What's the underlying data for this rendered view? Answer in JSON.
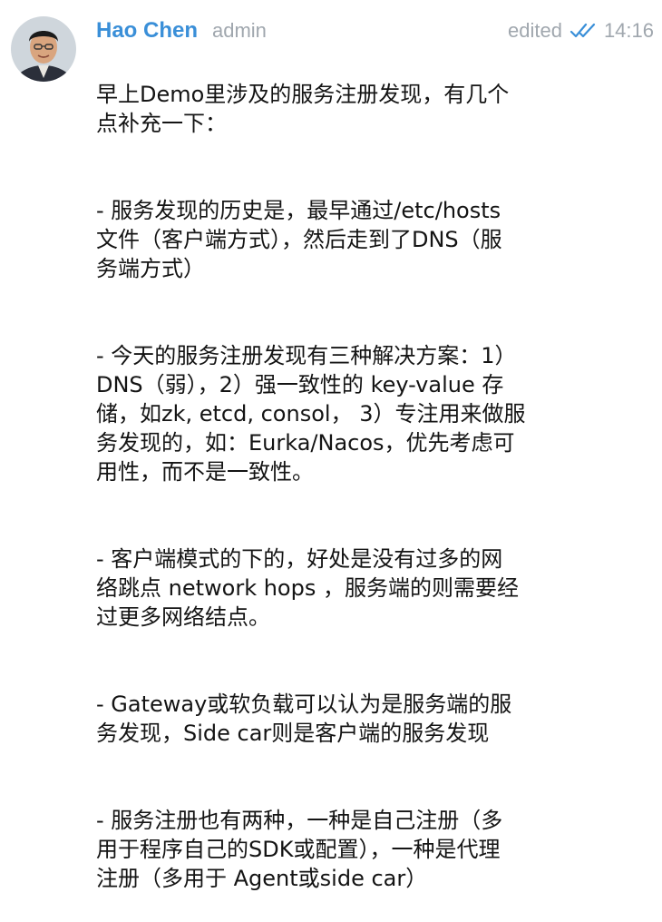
{
  "message": {
    "sender": "Hao Chen",
    "role": "admin",
    "edited_label": "edited",
    "time": "14:16",
    "status_icon": "double-check-icon",
    "accent_color": "#3a8fd8",
    "meta_color": "#a0a7ae",
    "paragraphs": [
      "早上Demo里涉及的服务注册发现，有几个\n点补充一下：",
      "- 服务发现的历史是，最早通过/etc/hosts\n文件（客户端方式），然后走到了DNS（服\n务端方式）",
      "- 今天的服务注册发现有三种解决方案：1）\nDNS（弱），2）强一致性的 key-value 存\n储，如zk, etcd, consol， 3）专注用来做服\n务发现的，如：Eurka/Nacos，优先考虑可\n用性，而不是一致性。",
      "- 客户端模式的下的，好处是没有过多的网\n络跳点 network hops ，服务端的则需要经\n过更多网络结点。",
      "- Gateway或软负载可以认为是服务端的服\n务发现，Side car则是客户端的服务发现",
      "- 服务注册也有两种，一种是自己注册（多\n用于程序自己的SDK或配置），一种是代理\n注册（多用于 Agent或side car）"
    ]
  }
}
